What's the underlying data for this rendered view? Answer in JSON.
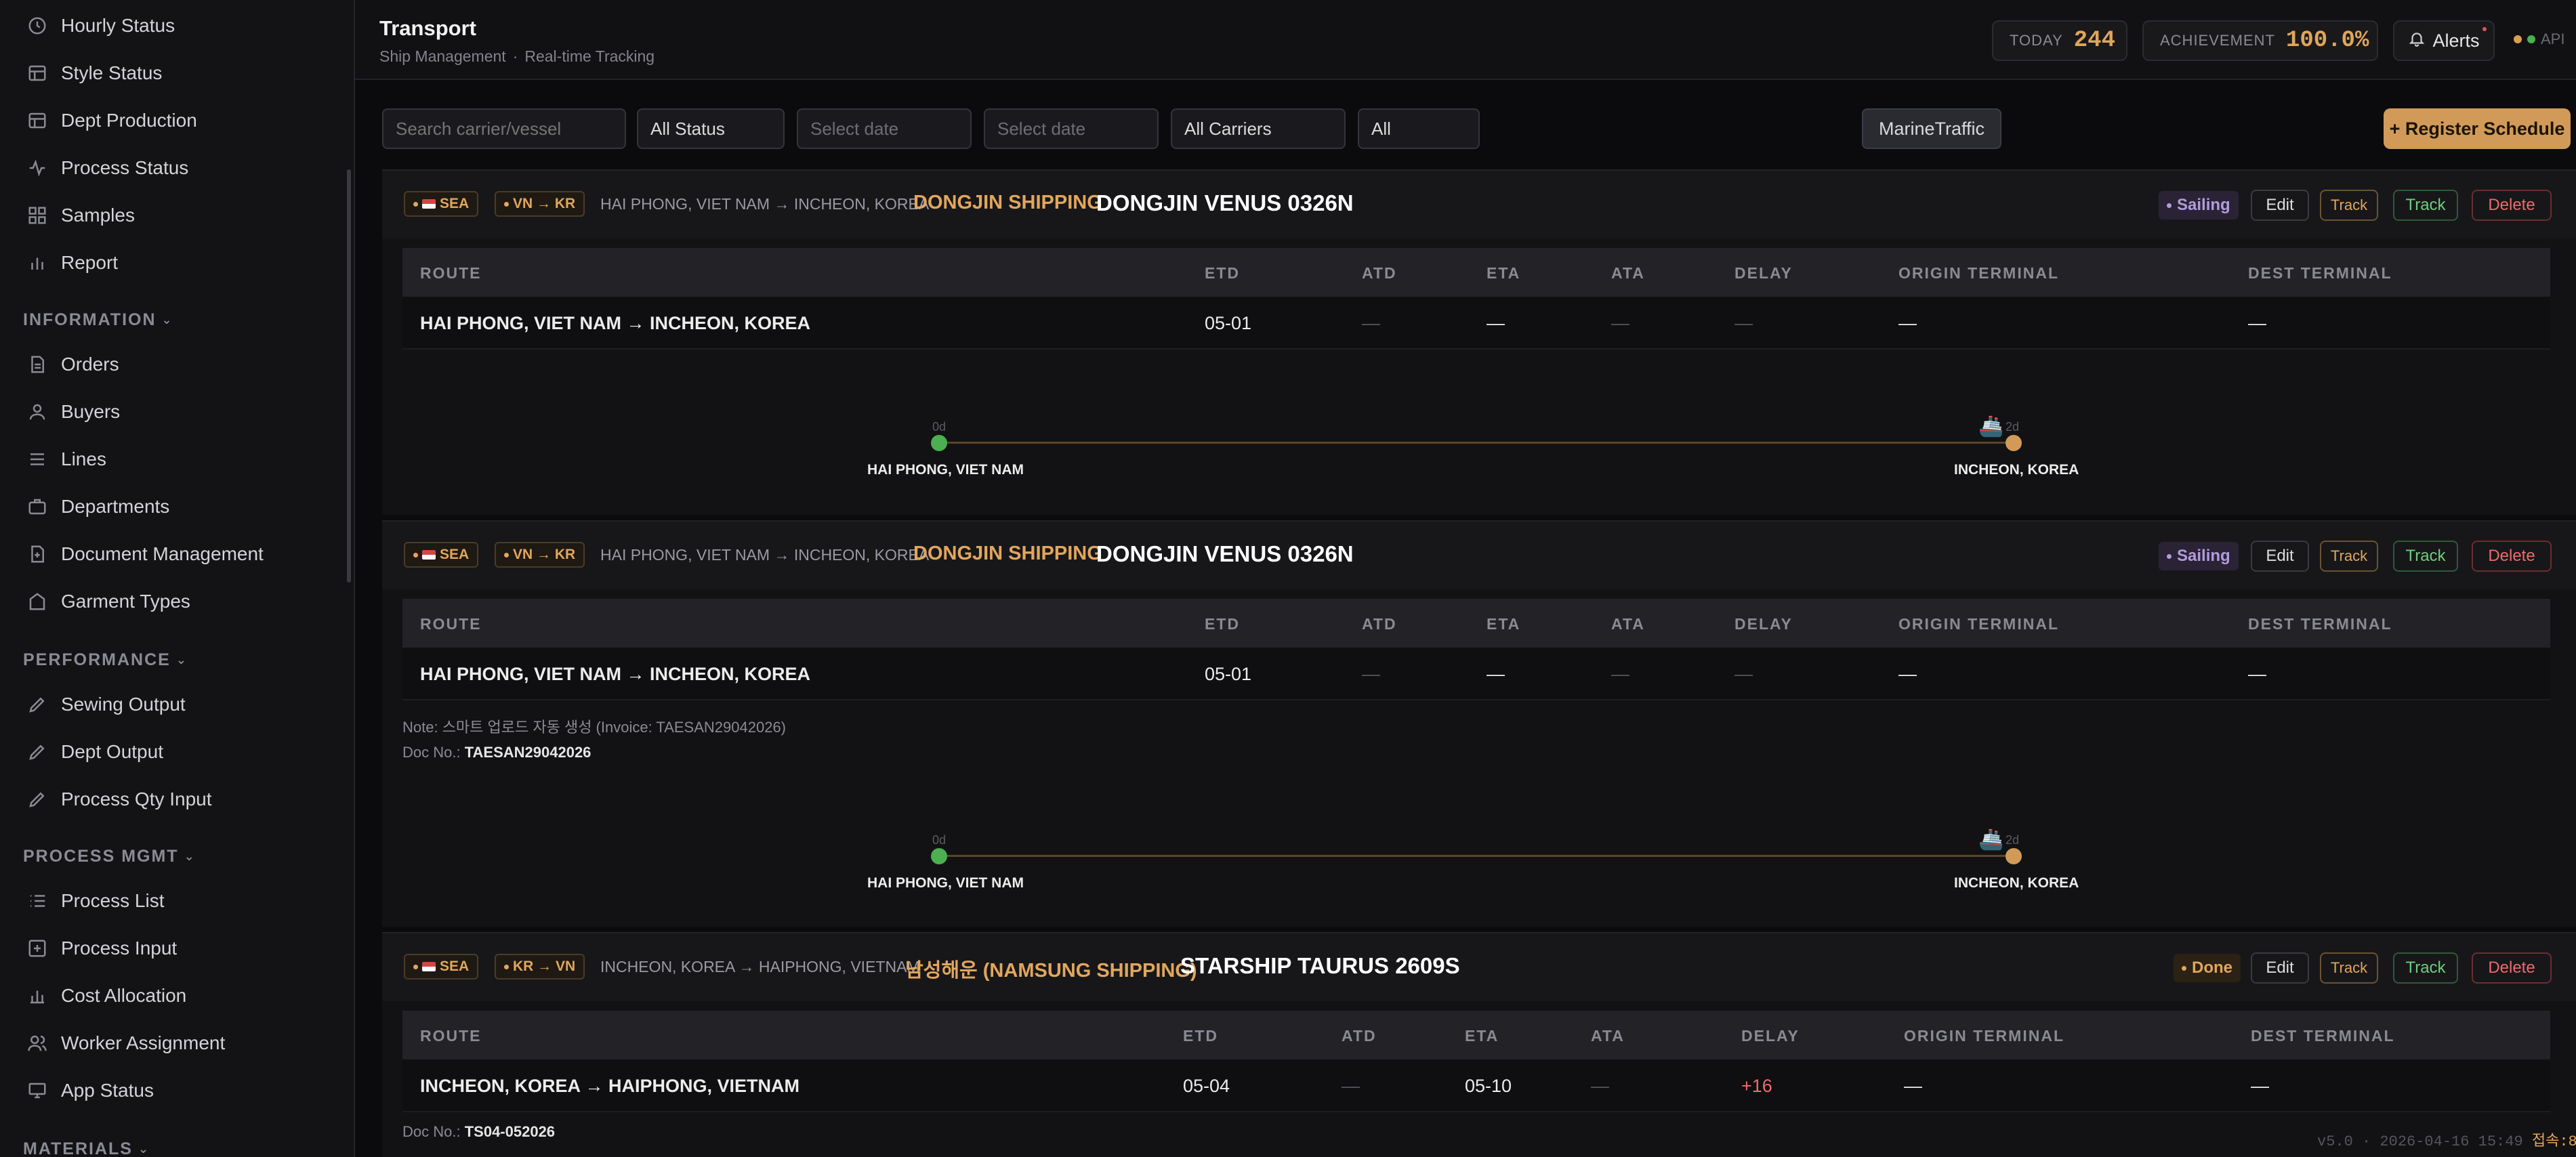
{
  "sidebar": {
    "items_top": [
      {
        "label": "Hourly Status",
        "icon": "clock-icon"
      },
      {
        "label": "Style Status",
        "icon": "table-icon"
      },
      {
        "label": "Dept Production",
        "icon": "table-icon"
      },
      {
        "label": "Process Status",
        "icon": "activity-icon"
      },
      {
        "label": "Samples",
        "icon": "grid-icon"
      },
      {
        "label": "Report",
        "icon": "bar-chart-icon"
      }
    ],
    "section_information": "INFORMATION",
    "items_information": [
      {
        "label": "Orders",
        "icon": "document-icon"
      },
      {
        "label": "Buyers",
        "icon": "user-icon"
      },
      {
        "label": "Lines",
        "icon": "list-icon"
      },
      {
        "label": "Departments",
        "icon": "briefcase-icon"
      },
      {
        "label": "Document Management",
        "icon": "file-plus-icon"
      },
      {
        "label": "Garment Types",
        "icon": "tag-icon"
      }
    ],
    "section_performance": "PERFORMANCE",
    "items_performance": [
      {
        "label": "Sewing Output",
        "icon": "pencil-icon"
      },
      {
        "label": "Dept Output",
        "icon": "pencil-icon"
      },
      {
        "label": "Process Qty Input",
        "icon": "pencil-icon"
      }
    ],
    "section_process": "PROCESS MGMT",
    "items_process": [
      {
        "label": "Process List",
        "icon": "list-ordered-icon"
      },
      {
        "label": "Process Input",
        "icon": "plus-square-icon"
      },
      {
        "label": "Cost Allocation",
        "icon": "bar-chart-icon"
      },
      {
        "label": "Worker Assignment",
        "icon": "users-icon"
      },
      {
        "label": "App Status",
        "icon": "monitor-icon"
      }
    ],
    "section_materials": "MATERIALS"
  },
  "header": {
    "title": "Transport",
    "breadcrumb_1": "Ship Management",
    "breadcrumb_sep": "·",
    "breadcrumb_2": "Real-time Tracking",
    "today_label": "TODAY",
    "today_value": "244",
    "achievement_label": "ACHIEVEMENT",
    "achievement_value": "100.0%",
    "alerts_label": "Alerts",
    "api_label": "API",
    "api_colors": [
      "#d9a04f",
      "#4caf50"
    ]
  },
  "filters": {
    "search_placeholder": "Search carrier/vessel",
    "status": "All Status",
    "date_from_placeholder": "Select date",
    "date_to_placeholder": "Select date",
    "carriers": "All Carriers",
    "all": "All",
    "marine_label": "MarineTraffic",
    "register_label": "+ Register Schedule"
  },
  "table_headers": [
    "ROUTE",
    "ETD",
    "ATD",
    "ETA",
    "ATA",
    "DELAY",
    "ORIGIN TERMINAL",
    "DEST TERMINAL"
  ],
  "shipments": [
    {
      "mode": "SEA",
      "direction": "VN → KR",
      "route_small": "HAI PHONG, VIET NAM → INCHEON, KOREA",
      "carrier": "DONGJIN SHIPPING",
      "vessel": "DONGJIN VENUS 0326N",
      "status": "Sailing",
      "row": {
        "route": "HAI PHONG, VIET NAM → INCHEON, KOREA",
        "etd": "05-01",
        "atd": "—",
        "eta": "—",
        "ata": "—",
        "delay": "—",
        "origin_terminal": "—",
        "dest_terminal": "—"
      },
      "timeline": {
        "start_day": "0d",
        "end_day": "2d",
        "origin": "HAI PHONG, VIET NAM",
        "dest": "INCHEON, KOREA"
      }
    },
    {
      "mode": "SEA",
      "direction": "VN → KR",
      "route_small": "HAI PHONG, VIET NAM → INCHEON, KOREA",
      "carrier": "DONGJIN SHIPPING",
      "vessel": "DONGJIN VENUS 0326N",
      "status": "Sailing",
      "row": {
        "route": "HAI PHONG, VIET NAM → INCHEON, KOREA",
        "etd": "05-01",
        "atd": "—",
        "eta": "—",
        "ata": "—",
        "delay": "—",
        "origin_terminal": "—",
        "dest_terminal": "—"
      },
      "note": "Note: 스마트 업로드 자동 생성 (Invoice: TAESAN29042026)",
      "doc_label": "Doc No.:",
      "doc_no": "TAESAN29042026",
      "timeline": {
        "start_day": "0d",
        "end_day": "2d",
        "origin": "HAI PHONG, VIET NAM",
        "dest": "INCHEON, KOREA"
      }
    },
    {
      "mode": "SEA",
      "direction": "KR → VN",
      "route_small": "INCHEON, KOREA → HAIPHONG, VIETNAM",
      "carrier": "남성해운 (NAMSUNG SHIPPING)",
      "vessel": "STARSHIP TAURUS 2609S",
      "status": "Done",
      "row": {
        "route": "INCHEON, KOREA → HAIPHONG, VIETNAM",
        "etd": "05-04",
        "atd": "—",
        "eta": "05-10",
        "ata": "—",
        "delay": "+16",
        "origin_terminal": "—",
        "dest_terminal": "—"
      },
      "doc_label": "Doc No.:",
      "doc_no": "TS04-052026"
    }
  ],
  "actions": {
    "edit": "Edit",
    "track_a": "Track",
    "track_b": "Track",
    "delete": "Delete"
  },
  "footer": {
    "version": "v5.0 · 2026-04-16 15:49",
    "users": "접속:8"
  },
  "colors": {
    "accent": "#d29a58",
    "sailing": "#b39bdb",
    "green": "#4caf50",
    "red": "#ee6b6b"
  }
}
